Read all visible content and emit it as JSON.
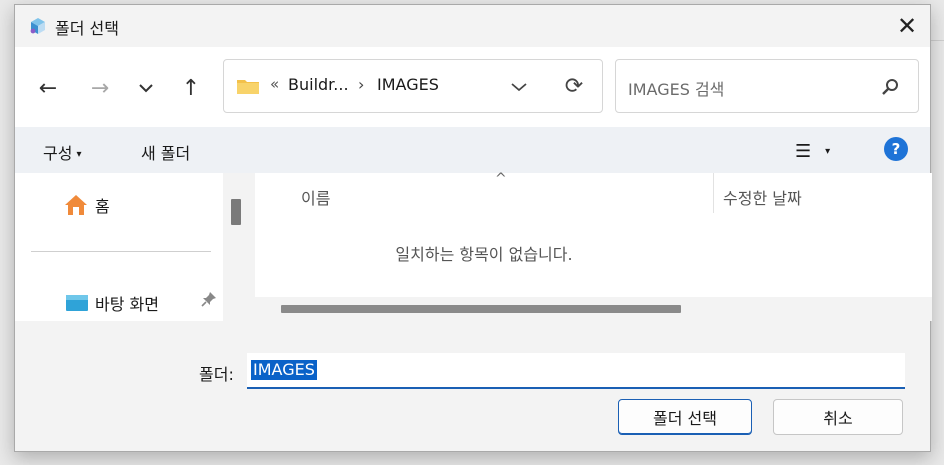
{
  "window": {
    "title": "폴더 선택",
    "close_glyph": "✕"
  },
  "nav": {
    "back_glyph": "←",
    "forward_glyph": "→",
    "recent_glyph": "⌄",
    "up_glyph": "↑"
  },
  "address": {
    "overflow_glyph": "«",
    "segments": [
      "Buildr...",
      "IMAGES"
    ],
    "separator": "›",
    "refresh_glyph": "⟳"
  },
  "search": {
    "placeholder": "IMAGES 검색"
  },
  "command_bar": {
    "organize_label": "구성",
    "organize_caret": "▾",
    "new_folder_label": "새 폴더",
    "view_glyph": "☰",
    "view_caret": "▾",
    "help_glyph": "?"
  },
  "nav_pane": {
    "items": [
      {
        "label": "홈",
        "icon": "home-icon"
      },
      {
        "label": "바탕 화면",
        "icon": "desktop-icon"
      }
    ],
    "pin_glyph": "📌"
  },
  "file_list": {
    "sort_glyph": "^",
    "columns": [
      "이름",
      "수정한 날짜"
    ],
    "empty_message": "일치하는 항목이 없습니다."
  },
  "footer": {
    "folder_label": "폴더:",
    "folder_value": "IMAGES",
    "select_button": "폴더 선택",
    "cancel_button": "취소"
  },
  "colors": {
    "accent": "#1a5fb4",
    "selection": "#0a62c8",
    "help": "#1e73d7",
    "folder": "#f3c14b"
  }
}
